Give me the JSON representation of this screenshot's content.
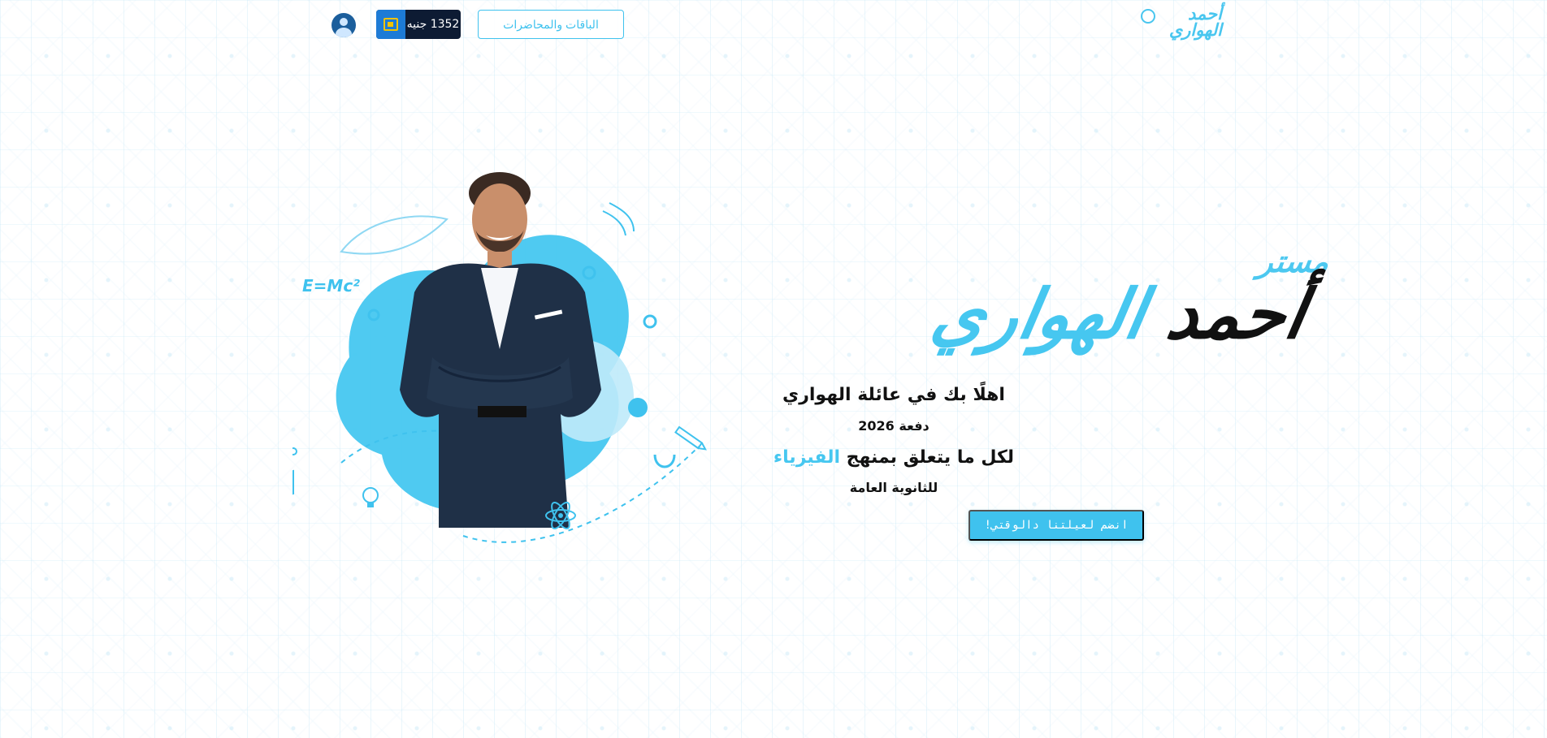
{
  "header": {
    "logo": {
      "line1": "أحمد",
      "line2": "الهواري"
    },
    "packages_button": "الباقات والمحاضرات",
    "balance": "1352 جنيه",
    "balance_icon": "wallet-icon",
    "avatar_icon": "user-avatar-icon"
  },
  "hero": {
    "title_prefix": "مستر",
    "name_first": "أحمد",
    "name_last": "الهواري",
    "welcome": "اهلًا بك في عائلة الهواري",
    "batch": "دفعة 2026",
    "curriculum_prefix": "لكل ما يتعلق بمنهج",
    "subject": "الفيزياء",
    "secondary": "للثانوية العامة",
    "join_button": "انضم لعيلتنا دالوقتي!"
  },
  "illustration": {
    "formula": "E=Mc²",
    "icons": [
      "atom-icon",
      "book-icon",
      "pencil-icon",
      "lightbulb-icon",
      "molecule-icon",
      "magnet-icon"
    ]
  },
  "colors": {
    "accent": "#46c7f0",
    "dark": "#0d1b33",
    "text": "#111111"
  }
}
